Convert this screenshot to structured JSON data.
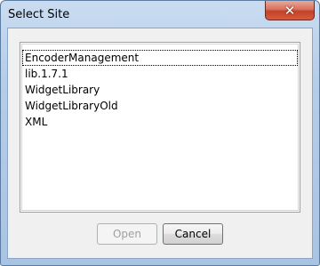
{
  "window": {
    "title": "Select Site",
    "close_glyph": "✕",
    "close_icon": "close-icon"
  },
  "site_list": {
    "items": [
      {
        "label": "EncoderManagement",
        "focused": true
      },
      {
        "label": "lib.1.7.1",
        "focused": false
      },
      {
        "label": "WidgetLibrary",
        "focused": false
      },
      {
        "label": "WidgetLibraryOld",
        "focused": false
      },
      {
        "label": "XML",
        "focused": false
      }
    ]
  },
  "buttons": {
    "open_label": "Open",
    "open_enabled": false,
    "cancel_label": "Cancel"
  },
  "colors": {
    "title_bar": "#b6cde8",
    "close_button": "#c3422a",
    "client_background": "#f0f0f0"
  }
}
